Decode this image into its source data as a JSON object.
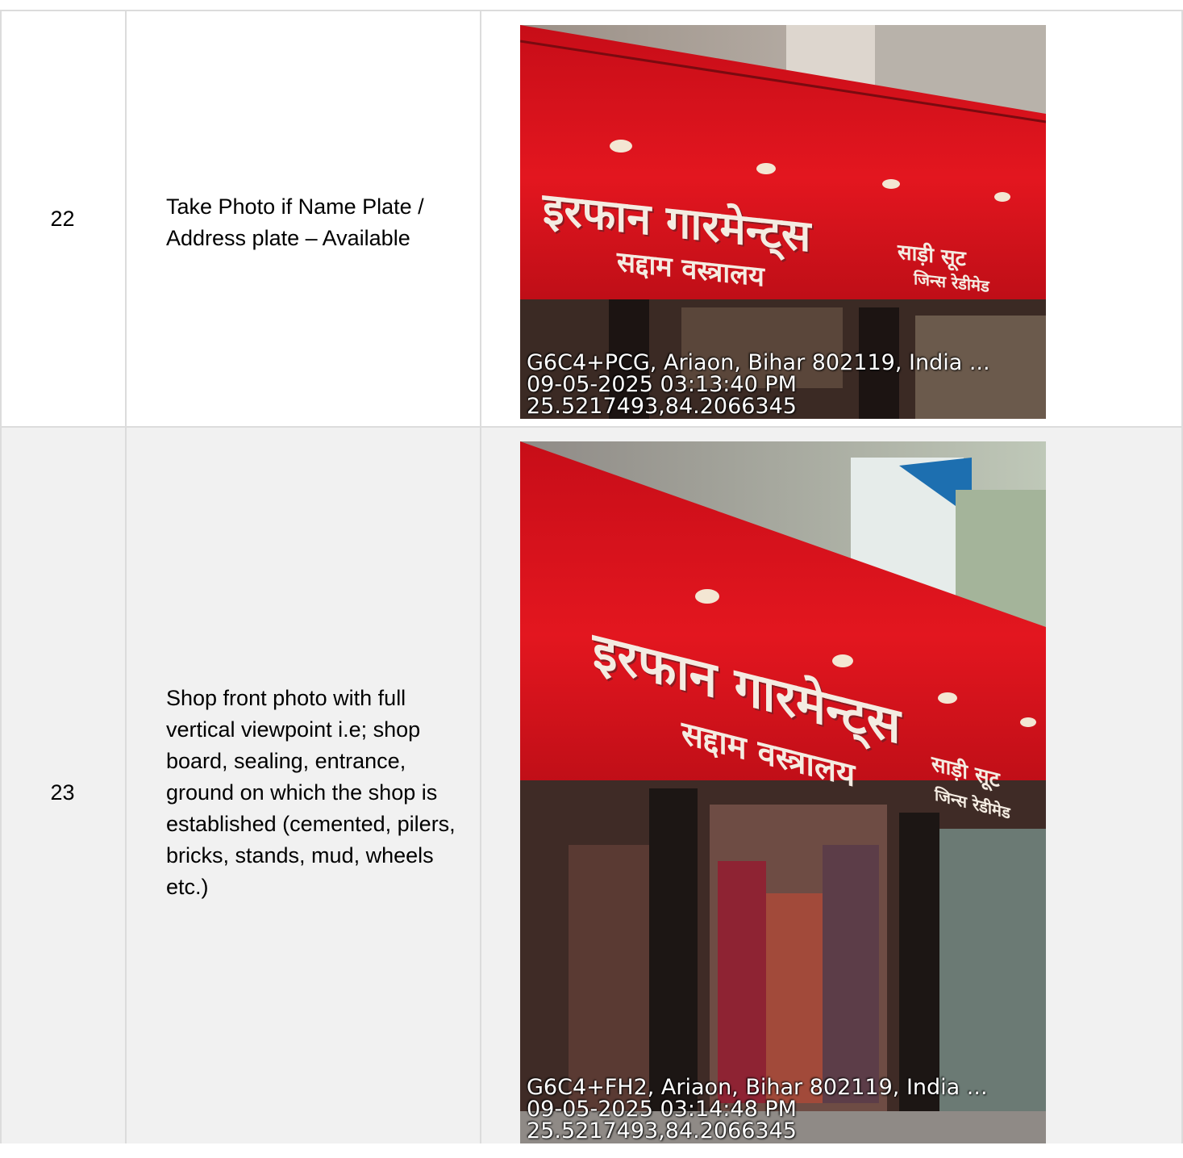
{
  "rows": [
    {
      "number": "22",
      "description": "Take Photo if Name Plate / Address plate – Available",
      "photo": {
        "address": "G6C4+PCG, Ariaon, Bihar 802119, India ...",
        "datetime": "09-05-2025 03:13:40 PM",
        "coordinates": "25.5217493,84.2066345",
        "sign_main": "इरफान गारमेन्ट्स",
        "sign_sub": "सद्दाम वस्त्रालय",
        "sign_side_1": "साड़ी सूट",
        "sign_side_2": "जिन्स रेडीमेड"
      }
    },
    {
      "number": "23",
      "description": "Shop front photo with full vertical viewpoint i.e; shop board, sealing, entrance, ground on which the shop is established (cemented, pilers, bricks, stands, mud, wheels etc.)",
      "photo": {
        "address": "G6C4+FH2, Ariaon, Bihar 802119, India ...",
        "datetime": "09-05-2025 03:14:48 PM",
        "coordinates": "25.5217493,84.2066345",
        "sign_main": "इरफान गारमेन्ट्स",
        "sign_sub": "सद्दाम वस्त्रालय",
        "sign_side_1": "साड़ी सूट",
        "sign_side_2": "जिन्स रेडीमेड"
      }
    }
  ],
  "colors": {
    "border": "#dcdcdc",
    "row_alt_background": "#f1f1f1",
    "sign_red": "#e0141e",
    "stamp_text": "#ffffff"
  }
}
